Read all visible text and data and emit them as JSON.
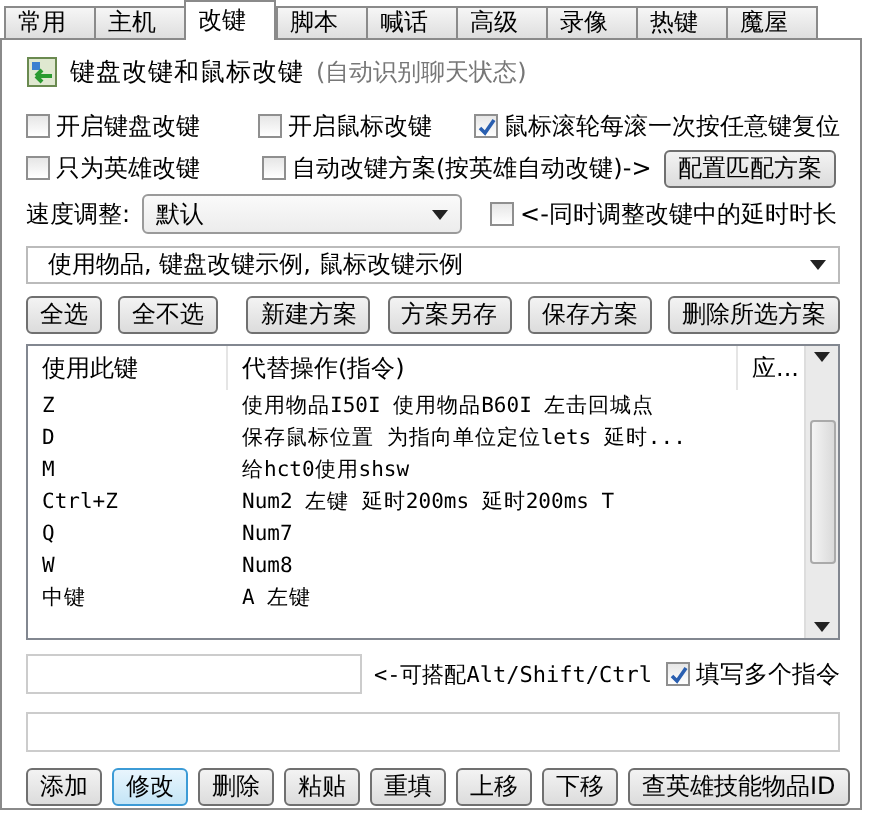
{
  "tabs": [
    {
      "label": "常用",
      "selected": false
    },
    {
      "label": "主机",
      "selected": false
    },
    {
      "label": "改键",
      "selected": true
    },
    {
      "label": "脚本",
      "selected": false
    },
    {
      "label": "喊话",
      "selected": false
    },
    {
      "label": "高级",
      "selected": false
    },
    {
      "label": "录像",
      "selected": false
    },
    {
      "label": "热键",
      "selected": false
    },
    {
      "label": "魔屋",
      "selected": false
    }
  ],
  "section": {
    "title": "键盘改键和鼠标改键",
    "subtitle": "(自动识别聊天状态)"
  },
  "options": [
    {
      "label": "开启键盘改键",
      "checked": false
    },
    {
      "label": "开启鼠标改键",
      "checked": false
    },
    {
      "label": "鼠标滚轮每滚一次按任意键复位",
      "checked": true
    },
    {
      "label": "只为英雄改键",
      "checked": false
    },
    {
      "label": "自动改键方案(按英雄自动改键)->",
      "checked": false
    }
  ],
  "match_button": "配置匹配方案",
  "speed": {
    "label": "速度调整:",
    "value": "默认",
    "sync": {
      "label": "<-同时调整改键中的延时时长",
      "checked": false
    }
  },
  "scheme": {
    "value": "使用物品, 键盘改键示例, 鼠标改键示例"
  },
  "scheme_buttons": [
    "全选",
    "全不选",
    "新建方案",
    "方案另存",
    "保存方案",
    "删除所选方案"
  ],
  "table": {
    "columns": [
      "使用此键",
      "代替操作(指令)",
      "应..."
    ],
    "rows": [
      {
        "key": "Z",
        "action": "使用物品I50I 使用物品B60I 左击回城点"
      },
      {
        "key": "D",
        "action": "保存鼠标位置 为指向单位定位lets 延时..."
      },
      {
        "key": "M",
        "action": "给hct0使用shsw"
      },
      {
        "key": "Ctrl+Z",
        "action": "Num2 左键 延时200ms 延时200ms T"
      },
      {
        "key": "Q",
        "action": "Num7"
      },
      {
        "key": "W",
        "action": "Num8"
      },
      {
        "key": "中键",
        "action": "A 左键"
      }
    ]
  },
  "key_hint": "<-可搭配Alt/Shift/Ctrl",
  "multi": {
    "label": "填写多个指令",
    "checked": true
  },
  "bottom_buttons": [
    {
      "label": "添加",
      "selected": false
    },
    {
      "label": "修改",
      "selected": true
    },
    {
      "label": "删除",
      "selected": false
    },
    {
      "label": "粘贴",
      "selected": false
    },
    {
      "label": "重填",
      "selected": false
    },
    {
      "label": "上移",
      "selected": false
    },
    {
      "label": "下移",
      "selected": false
    },
    {
      "label": "查英雄技能物品ID",
      "selected": false
    }
  ]
}
